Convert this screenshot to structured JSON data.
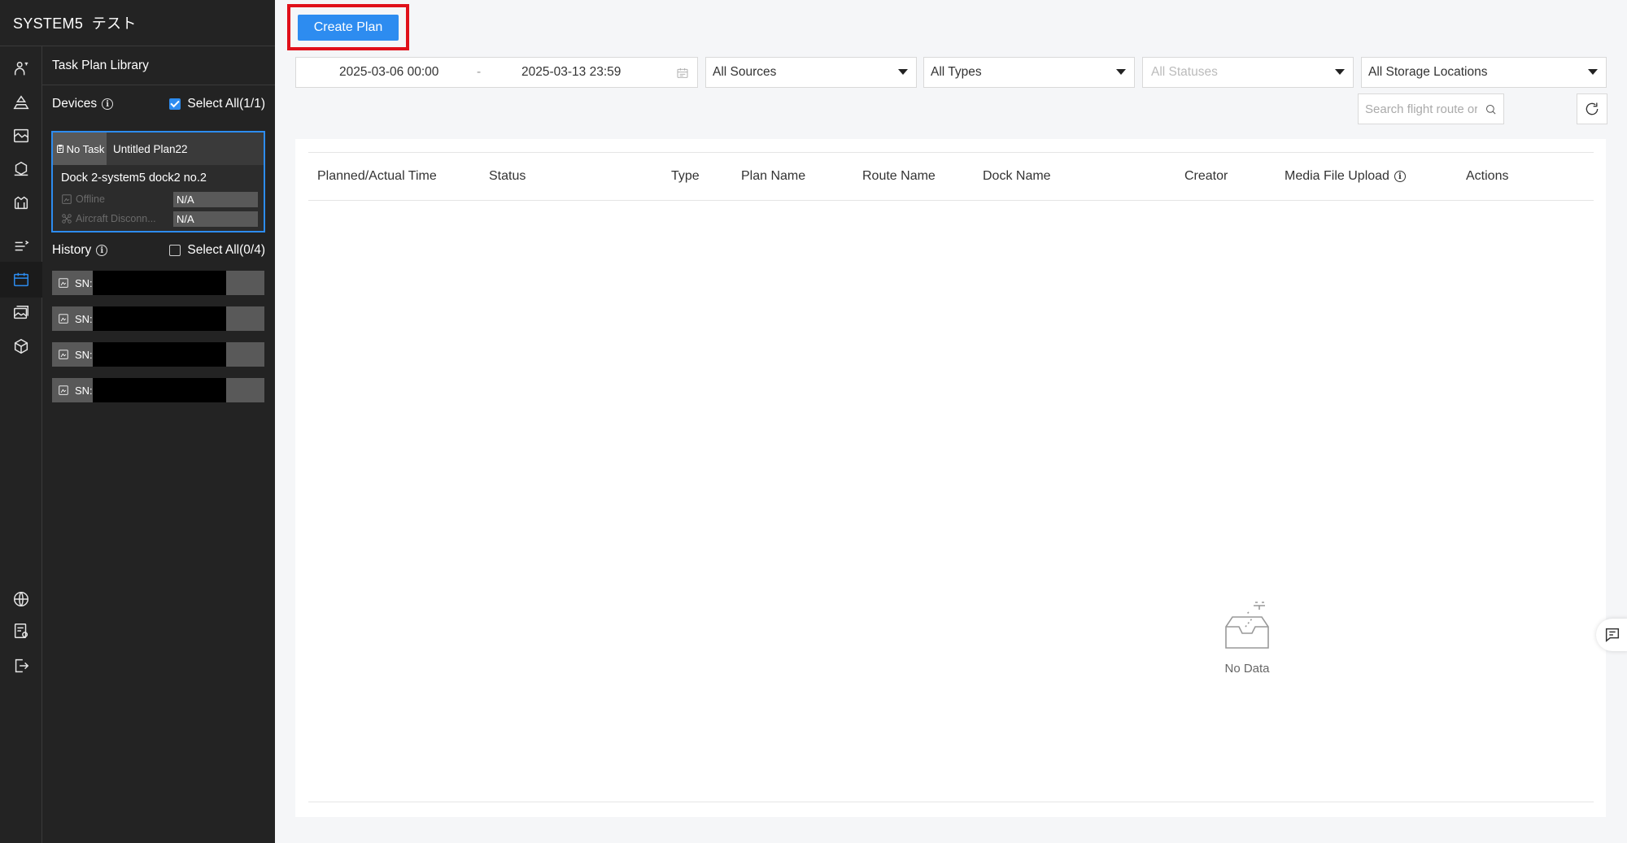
{
  "app": {
    "title": "SYSTEM5  テスト"
  },
  "panel": {
    "title": "Task Plan Library",
    "devices_label": "Devices",
    "devices_select_all": "Select All(1/1)",
    "devices_select_all_checked": true,
    "device_card": {
      "task_badge": "No Task",
      "plan_name": "Untitled Plan22",
      "device_name": "Dock 2-system5 dock2 no.2",
      "dock_status_label": "Offline",
      "dock_status_value": "N/A",
      "aircraft_status_label": "Aircraft Disconn...",
      "aircraft_status_value": "N/A"
    },
    "history_label": "History",
    "history_select_all": "Select All(0/4)",
    "history_select_all_checked": false,
    "history_items": [
      {
        "sn_label": "SN:"
      },
      {
        "sn_label": "SN:"
      },
      {
        "sn_label": "SN:"
      },
      {
        "sn_label": "SN:"
      }
    ]
  },
  "toolbar": {
    "create_plan": "Create Plan",
    "date_start": "2025-03-06 00:00",
    "date_separator": "-",
    "date_end": "2025-03-13 23:59",
    "sources": "All Sources",
    "types": "All Types",
    "statuses": "All Statuses",
    "storage": "All Storage Locations",
    "search_placeholder": "Search flight route or plan na..."
  },
  "table": {
    "columns": [
      "Planned/Actual Time",
      "Status",
      "Type",
      "Plan Name",
      "Route Name",
      "Dock Name",
      "Creator",
      "Media File Upload",
      "Actions"
    ],
    "empty_text": "No Data"
  },
  "colors": {
    "accent": "#2d8cf0",
    "sidebar_bg": "#232323",
    "highlight_border": "#e0101a"
  },
  "icons": {
    "rail": [
      "drone-team-icon",
      "annotation-icon",
      "map-layers-icon",
      "device-icon",
      "dock-icon",
      "route-list-icon",
      "calendar-icon",
      "media-icon",
      "model-cube-icon",
      "globe-icon",
      "settings-list-icon",
      "logout-icon"
    ]
  }
}
